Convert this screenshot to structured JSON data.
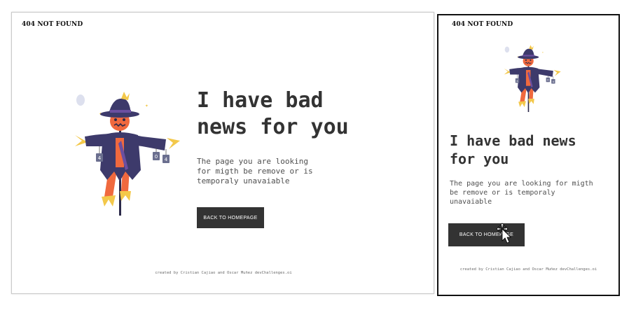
{
  "desktop": {
    "brand": "404 NOT FOUND",
    "headline": "I have bad news for you",
    "description": "The page you are looking for migth be remove or is temporaly unavaiable",
    "button_label": "BACK TO HOMEPAGE",
    "footer": "created by Cristian Cajiao and Oscar Muñez devChallenges.oi"
  },
  "mobile": {
    "brand": "404 NOT FOUND",
    "headline": "I have bad news for you",
    "description": "The page you are looking for migth be remove or is temporaly unavaiable",
    "button_label": "BACK TO HOMEPAGE",
    "footer": "created by Cristian Cajiao and Oscar Muñez devChallenges.oi"
  },
  "illustration": {
    "tags": [
      "4",
      "0",
      "4"
    ]
  },
  "colors": {
    "dark": "#333333",
    "hat": "#3d3a6b",
    "face": "#f0693e",
    "straw": "#f3c84a",
    "background": "#ffffff"
  }
}
